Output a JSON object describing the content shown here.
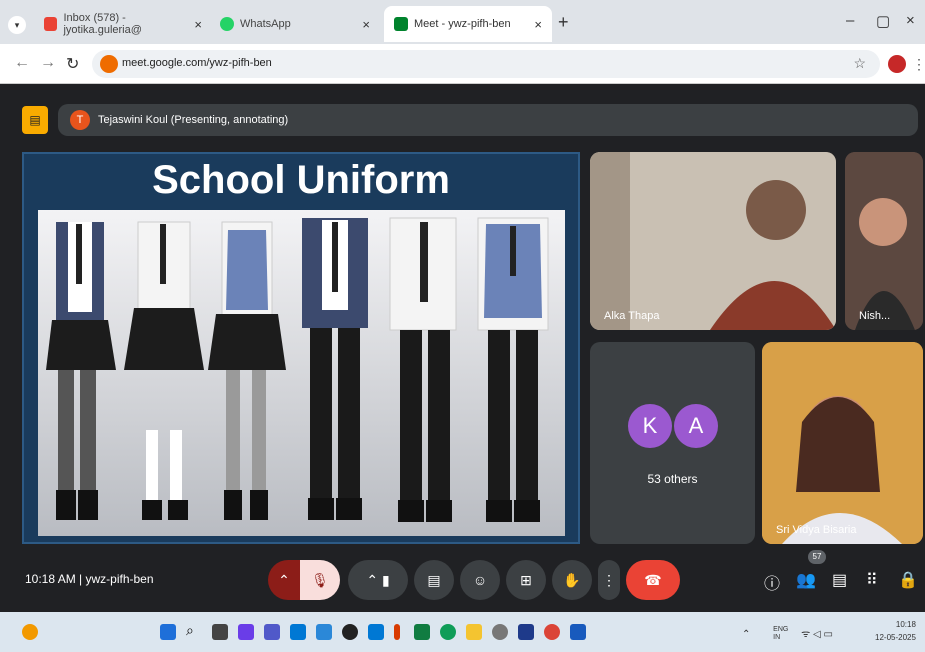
{
  "browser": {
    "tabs": [
      {
        "label": "Inbox (578) - jyotika.guleria@",
        "color": "#ea4335",
        "active": false
      },
      {
        "label": "WhatsApp",
        "color": "#25d366",
        "active": false
      },
      {
        "label": "Meet - ywz-pifh-ben",
        "color": "#00832d",
        "active": true
      }
    ],
    "new_tab": "+",
    "url": "meet.google.com/ywz-pifh-ben",
    "window_controls": {
      "minimize": "–",
      "restore": "▢",
      "close": "×"
    }
  },
  "meet": {
    "presenter_initial": "T",
    "presenter_label": "Tejaswini Koul (Presenting, annotating)",
    "slide": {
      "title": "School Uniform"
    },
    "participants": [
      {
        "name": "Alka Thapa"
      },
      {
        "name": "Nish..."
      },
      {
        "name": "Sri Vidya Bisaria"
      }
    ],
    "others": {
      "avatars": [
        "K",
        "A"
      ],
      "label": "53 others"
    },
    "time": "10:18 AM",
    "meeting_code": "ywz-pifh-ben",
    "people_count": "57"
  },
  "taskbar": {
    "lang": "ENG",
    "region": "IN",
    "time": "10:18",
    "date": "12-05-2025"
  }
}
